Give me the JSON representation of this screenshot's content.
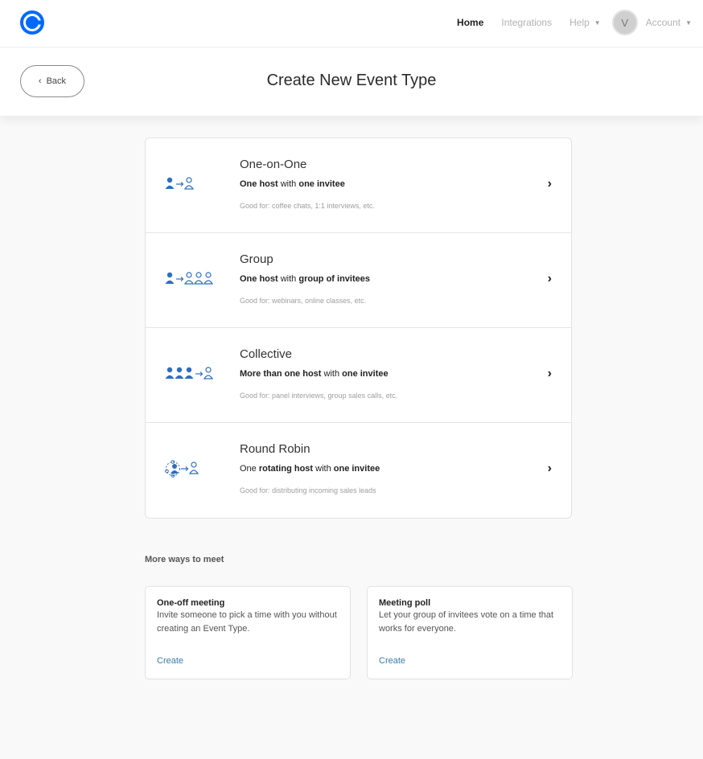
{
  "nav": {
    "home": "Home",
    "integrations": "Integrations",
    "help": "Help",
    "avatar_initial": "V",
    "account": "Account"
  },
  "header": {
    "back_label": "Back",
    "title": "Create New Event Type"
  },
  "event_types": [
    {
      "name": "One-on-One",
      "desc_parts": [
        {
          "text": "One host",
          "bold": true
        },
        {
          "text": " with ",
          "bold": false
        },
        {
          "text": "one invitee",
          "bold": true
        }
      ],
      "good_for": "Good for: coffee chats, 1:1 interviews, etc.",
      "icon": "one-on-one-icon"
    },
    {
      "name": "Group",
      "desc_parts": [
        {
          "text": "One host",
          "bold": true
        },
        {
          "text": " with ",
          "bold": false
        },
        {
          "text": "group of invitees",
          "bold": true
        }
      ],
      "good_for": "Good for: webinars, online classes, etc.",
      "icon": "group-icon"
    },
    {
      "name": "Collective",
      "desc_parts": [
        {
          "text": "More than one host",
          "bold": true
        },
        {
          "text": " with ",
          "bold": false
        },
        {
          "text": "one invitee",
          "bold": true
        }
      ],
      "good_for": "Good for: panel interviews, group sales calls, etc.",
      "icon": "collective-icon"
    },
    {
      "name": "Round Robin",
      "desc_parts": [
        {
          "text": "One ",
          "bold": false
        },
        {
          "text": "rotating host",
          "bold": true
        },
        {
          "text": " with ",
          "bold": false
        },
        {
          "text": "one invitee",
          "bold": true
        }
      ],
      "good_for": "Good for: distributing incoming sales leads",
      "icon": "round-robin-icon"
    }
  ],
  "more_ways": {
    "title": "More ways to meet",
    "cards": [
      {
        "title": "One-off meeting",
        "desc": "Invite someone to pick a time with you without creating an Event Type.",
        "action": "Create"
      },
      {
        "title": "Meeting poll",
        "desc": "Let your group of invitees vote on a time that works for everyone.",
        "action": "Create"
      }
    ]
  },
  "colors": {
    "brand": "#0069ff",
    "icon_blue": "#2d6ec1",
    "link": "#3a7ca8"
  }
}
